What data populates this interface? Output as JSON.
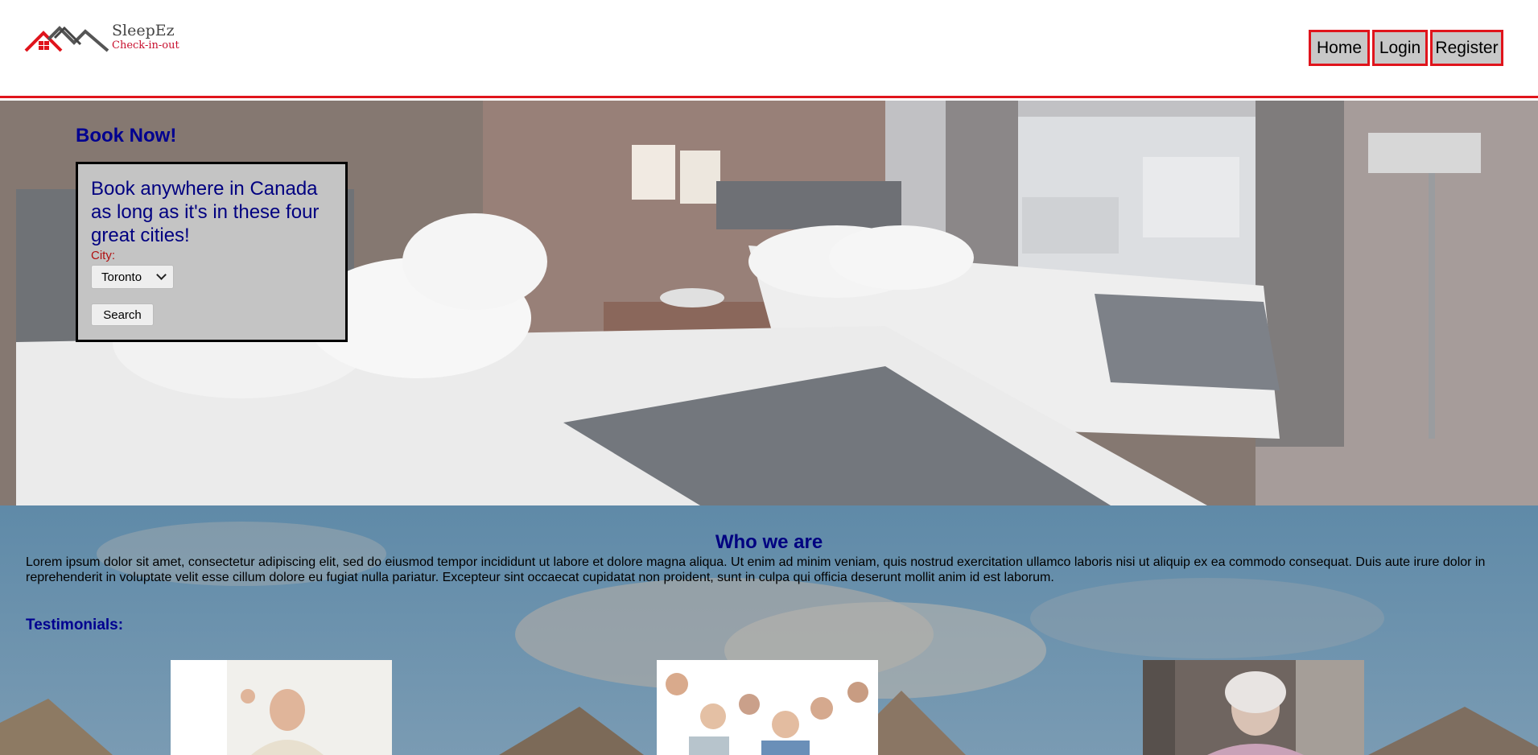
{
  "brand": {
    "name": "SleepEz",
    "tagline": "Check-in-out"
  },
  "nav": {
    "home": "Home",
    "login": "Login",
    "register": "Register"
  },
  "booking": {
    "title": "Book Now!",
    "heading": "Book anywhere in Canada as long as it's in these four great cities!",
    "city_label": "City:",
    "city_selected": "Toronto",
    "search_label": "Search"
  },
  "about": {
    "title": "Who we are",
    "body": "Lorem ipsum dolor sit amet, consectetur adipiscing elit, sed do eiusmod tempor incididunt ut labore et dolore magna aliqua. Ut enim ad minim veniam, quis nostrud exercitation ullamco laboris nisi ut aliquip ex ea commodo consequat. Duis aute irure dolor in reprehenderit in voluptate velit esse cillum dolore eu fugiat nulla pariatur. Excepteur sint occaecat cupidatat non proident, sunt in culpa qui officia deserunt mollit anim id est laborum.",
    "testimonials_label": "Testimonials:"
  },
  "colors": {
    "accent_red": "#e0141c",
    "heading_navy": "#000080"
  }
}
